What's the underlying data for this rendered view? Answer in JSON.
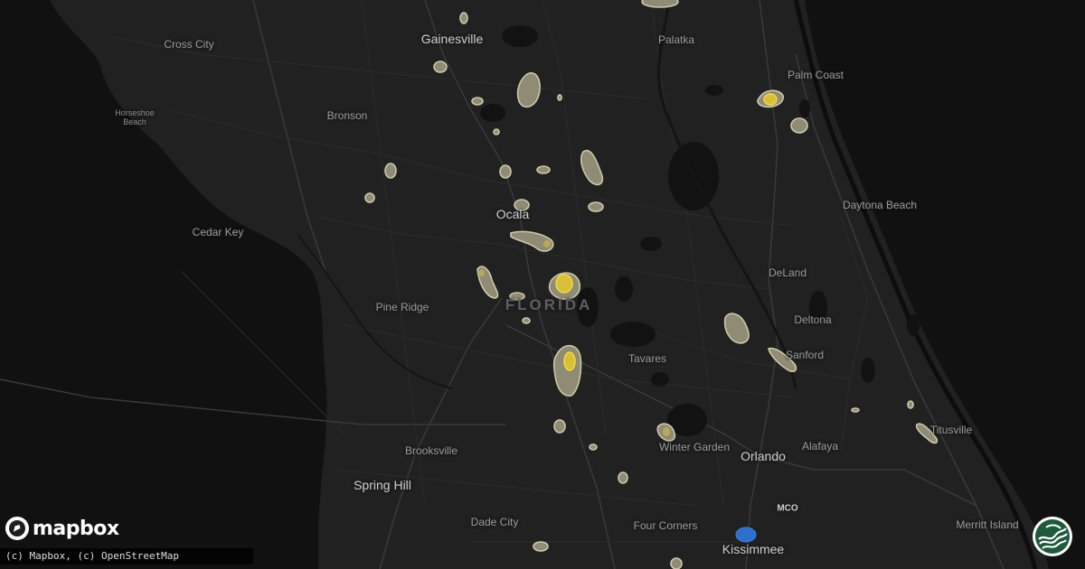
{
  "map": {
    "state_label": "FLORIDA",
    "theme": "dark",
    "colors": {
      "land": "#212121",
      "water": "#0d0d0d",
      "roads": "#333333",
      "highways": "#3a3a3a",
      "hail_outer": "#cdc8a8",
      "hail_core": "#f0d84a",
      "hail_blue": "#2e6fc9"
    },
    "cities": [
      {
        "name": "Gainesville",
        "major": true
      },
      {
        "name": "Palatka"
      },
      {
        "name": "Cross City"
      },
      {
        "name": "Palm Coast"
      },
      {
        "name": "Horseshoe Beach",
        "small": true
      },
      {
        "name": "Bronson"
      },
      {
        "name": "Daytona Beach"
      },
      {
        "name": "Ocala",
        "major": true
      },
      {
        "name": "Cedar Key"
      },
      {
        "name": "DeLand"
      },
      {
        "name": "Pine Ridge"
      },
      {
        "name": "Deltona"
      },
      {
        "name": "Sanford"
      },
      {
        "name": "Tavares"
      },
      {
        "name": "Titusville"
      },
      {
        "name": "Winter Garden"
      },
      {
        "name": "Orlando",
        "major": true
      },
      {
        "name": "Alafaya"
      },
      {
        "name": "Brooksville"
      },
      {
        "name": "Spring Hill",
        "major": true
      },
      {
        "name": "MCO",
        "airport": true
      },
      {
        "name": "Dade City"
      },
      {
        "name": "Four Corners"
      },
      {
        "name": "Merritt Island"
      },
      {
        "name": "Kissimmee",
        "major": true
      }
    ]
  },
  "logo": {
    "text": "mapbox",
    "icon": "mapbox-logo-icon"
  },
  "attribution": "(c) Mapbox, (c) OpenStreetMap",
  "brand_badge": {
    "icon": "wave-logo-icon"
  }
}
